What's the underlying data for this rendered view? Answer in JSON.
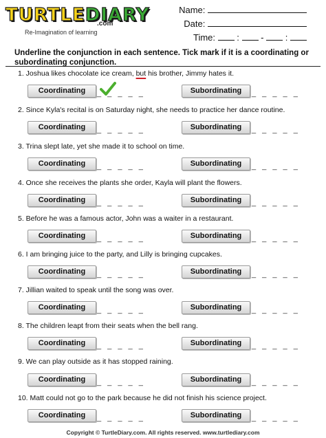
{
  "logo": {
    "word_a": "TURTLE",
    "word_b": "DIARY",
    "dotcom": ".com",
    "tagline": "Re-Imagination of learning"
  },
  "header": {
    "name_label": "Name:",
    "date_label": "Date:",
    "time_label": "Time:",
    "time_sep_colon": ":",
    "time_sep_dash": "-"
  },
  "instructions": "Underline the conjunction in each sentence. Tick mark if it is a coordinating or subordinating conjunction.",
  "buttons": {
    "coordinating": "Coordinating",
    "subordinating": "Subordinating"
  },
  "answer_blank": "_ _ _ _ _",
  "questions": [
    {
      "pre": "1. Joshua likes chocolate ice cream, ",
      "conj": "but",
      "post": " his brother, Jimmy hates it."
    },
    {
      "text": "2. Since Kyla's recital is on Saturday night, she needs to practice her dance routine."
    },
    {
      "text": "3. Trina slept late, yet she made it to school on time."
    },
    {
      "text": "4. Once she receives the plants she order, Kayla will plant the flowers."
    },
    {
      "text": "5. Before he was a famous actor, John was a waiter in a restaurant."
    },
    {
      "text": "6. I am bringing juice to the party, and Lilly is bringing cupcakes."
    },
    {
      "text": "7. Jillian waited to speak until the song was over."
    },
    {
      "text": "8. The children leapt from their seats when the bell rang."
    },
    {
      "text": "9. We can play outside as it has stopped raining."
    },
    {
      "text": "10. Matt could not go to the park because he did not finish his science project."
    }
  ],
  "footer": "Copyright © TurtleDiary.com. All rights reserved. www.turtlediary.com",
  "colors": {
    "tick": "#4caf2e",
    "underline": "#d0202a"
  }
}
